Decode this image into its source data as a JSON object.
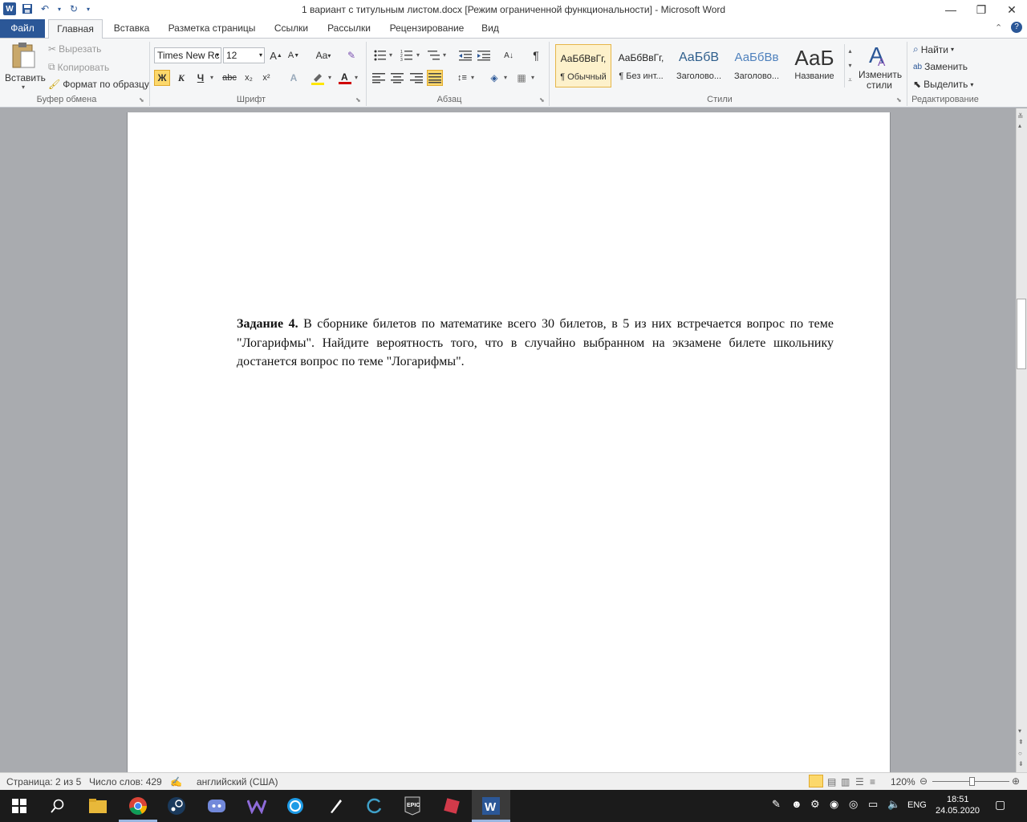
{
  "window": {
    "title": "1  вариант с титульным листом.docx [Режим ограниченной функциональности] - Microsoft Word",
    "minimize": "—",
    "restore": "❐",
    "close": "✕"
  },
  "ribbon_tabs": [
    "Файл",
    "Главная",
    "Вставка",
    "Разметка страницы",
    "Ссылки",
    "Рассылки",
    "Рецензирование",
    "Вид"
  ],
  "clipboard": {
    "paste": "Вставить",
    "cut": "Вырезать",
    "copy": "Копировать",
    "format_painter": "Формат по образцу",
    "group": "Буфер обмена"
  },
  "font": {
    "name": "Times New Rc",
    "size": "12",
    "group": "Шрифт",
    "bold": "Ж",
    "italic": "К",
    "underline": "Ч",
    "strike": "abc",
    "subscript": "x₂",
    "superscript": "x²",
    "change_case": "Aa"
  },
  "paragraph": {
    "group": "Абзац",
    "pilcrow": "¶"
  },
  "styles": {
    "group": "Стили",
    "items": [
      {
        "preview": "АаБбВвГг,",
        "name": "¶ Обычный"
      },
      {
        "preview": "АаБбВвГг,",
        "name": "¶ Без инт..."
      },
      {
        "preview": "АаБбВ",
        "name": "Заголово..."
      },
      {
        "preview": "АаБбВв",
        "name": "Заголово..."
      },
      {
        "preview": "АаБ",
        "name": "Название"
      }
    ],
    "change_styles_1": "Изменить",
    "change_styles_2": "стили"
  },
  "editing": {
    "group": "Редактирование",
    "find": "Найти",
    "replace": "Заменить",
    "select": "Выделить"
  },
  "document": {
    "task_label": "Задание 4.",
    "task_text": " В сборнике билетов по математике  всего 30 билетов, в 5 из них встречается вопрос по теме \"Логарифмы\". Найдите вероятность того, что в случайно выбранном на экзамене билете школьнику достанется вопрос по теме \"Логарифмы\"."
  },
  "status": {
    "page": "Страница: 2 из 5",
    "words": "Число слов: 429",
    "language": "английский (США)",
    "zoom": "120%"
  },
  "tray": {
    "lang": "ENG",
    "time": "18:51",
    "date": "24.05.2020"
  },
  "colors": {
    "accent": "#2b5797",
    "highlight": "#ffe600",
    "font_color": "#d00000"
  }
}
